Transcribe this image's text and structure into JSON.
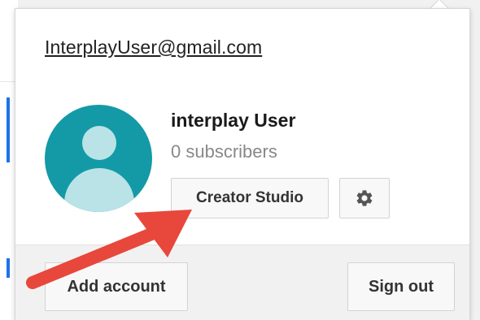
{
  "account": {
    "email": "InterplayUser@gmail.com",
    "name": "interplay User",
    "subscribers": "0 subscribers"
  },
  "buttons": {
    "creator_studio": "Creator Studio",
    "add_account": "Add account",
    "sign_out": "Sign out"
  },
  "icons": {
    "settings": "gear-icon",
    "avatar": "default-avatar-icon",
    "annotation": "red-arrow"
  },
  "colors": {
    "avatar_bg": "#139aa6",
    "avatar_fg": "#b9e3e6",
    "arrow": "#e8473c"
  }
}
